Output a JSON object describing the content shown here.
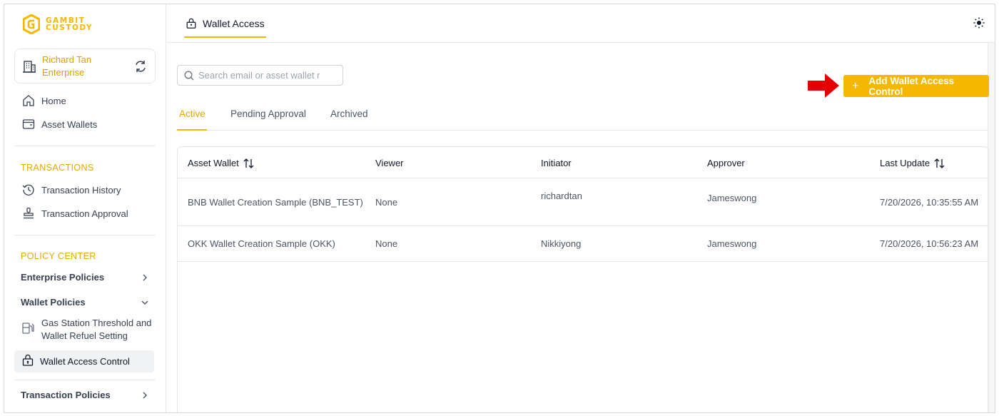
{
  "brand": {
    "line1": "GAMBIT",
    "line2": "CUSTODY",
    "color": "#f5b800"
  },
  "enterprise": {
    "name": "Richard Tan Enterprise"
  },
  "sidebar": {
    "home": "Home",
    "asset_wallets": "Asset Wallets",
    "transactions_title": "TRANSACTIONS",
    "transaction_history": "Transaction History",
    "transaction_approval": "Transaction Approval",
    "policy_center_title": "POLICY CENTER",
    "enterprise_policies": "Enterprise Policies",
    "wallet_policies": "Wallet Policies",
    "gas_station_line1": "Gas Station Threshold and",
    "gas_station_line2": "Wallet Refuel Setting",
    "wallet_access_control": "Wallet Access Control",
    "transaction_policies": "Transaction Policies"
  },
  "header": {
    "title": "Wallet Access"
  },
  "search": {
    "placeholder": "Search email or asset wallet name"
  },
  "add_button": {
    "label": "Add Wallet Access Control",
    "plus": "+"
  },
  "tabs": [
    {
      "label": "Active",
      "active": true
    },
    {
      "label": "Pending Approval",
      "active": false
    },
    {
      "label": "Archived",
      "active": false
    }
  ],
  "table": {
    "columns": [
      "Asset Wallet",
      "Viewer",
      "Initiator",
      "Approver",
      "Last Update"
    ],
    "rows": [
      [
        "BNB Wallet Creation Sample (BNB_TEST)",
        "None",
        "richardtan",
        "Jameswong",
        "7/20/2026, 10:35:55 AM"
      ],
      [
        "OKK Wallet Creation Sample (OKK)",
        "None",
        "Nikkiyong",
        "Jameswong",
        "7/20/2026, 10:56:23 AM"
      ]
    ]
  },
  "icons": {
    "sort": "sort-arrows-icon",
    "arrow_color": "#e30000"
  }
}
